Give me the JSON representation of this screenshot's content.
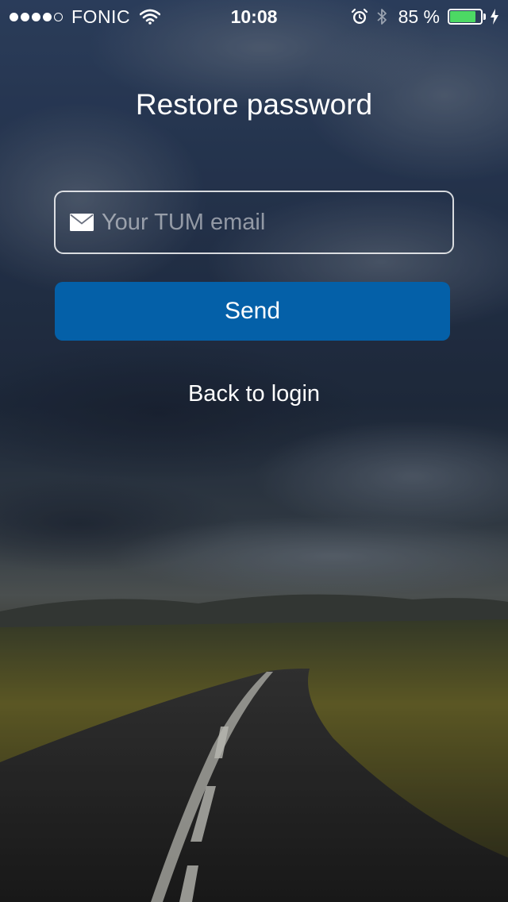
{
  "status_bar": {
    "carrier": "FONIC",
    "time": "10:08",
    "battery_percent": "85 %",
    "battery_level": 0.85,
    "signal_bars_filled": 4,
    "signal_bars_total": 5,
    "icons": [
      "wifi-icon",
      "alarm-icon",
      "bluetooth-icon",
      "battery-icon",
      "charging-icon"
    ],
    "battery_color": "#4cd964"
  },
  "screen": {
    "title": "Restore password",
    "email": {
      "placeholder": "Your TUM email",
      "value": "",
      "icon": "mail-icon"
    },
    "send_label": "Send",
    "back_label": "Back to login"
  },
  "colors": {
    "button": "#0460a8",
    "text": "#ffffff"
  }
}
